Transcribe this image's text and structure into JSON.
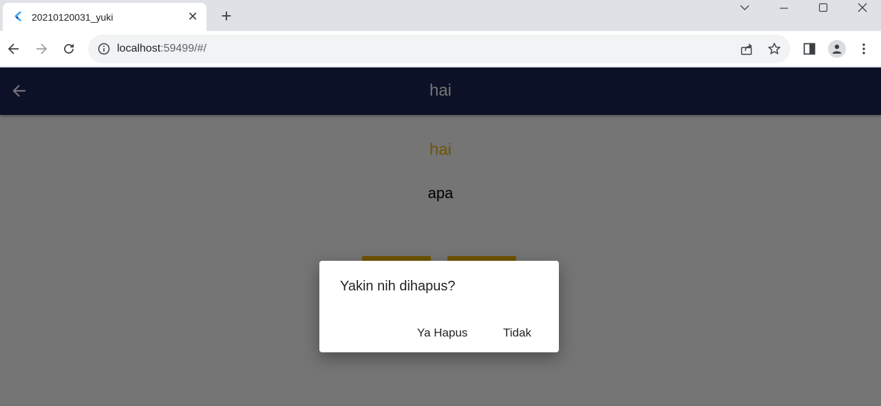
{
  "browser": {
    "tab": {
      "title": "20210120031_yuki",
      "favicon": "flutter-icon",
      "close_glyph": "✕"
    },
    "new_tab_glyph": "+",
    "url_host": "localhost",
    "url_rest": ":59499/#/"
  },
  "app": {
    "appbar_title": "hai",
    "item_title": "hai",
    "item_description": "apa",
    "colors": {
      "appbar": "#1e2557",
      "accent": "#f2b705"
    }
  },
  "dialog": {
    "message": "Yakin nih dihapus?",
    "confirm_label": "Ya Hapus",
    "cancel_label": "Tidak"
  }
}
